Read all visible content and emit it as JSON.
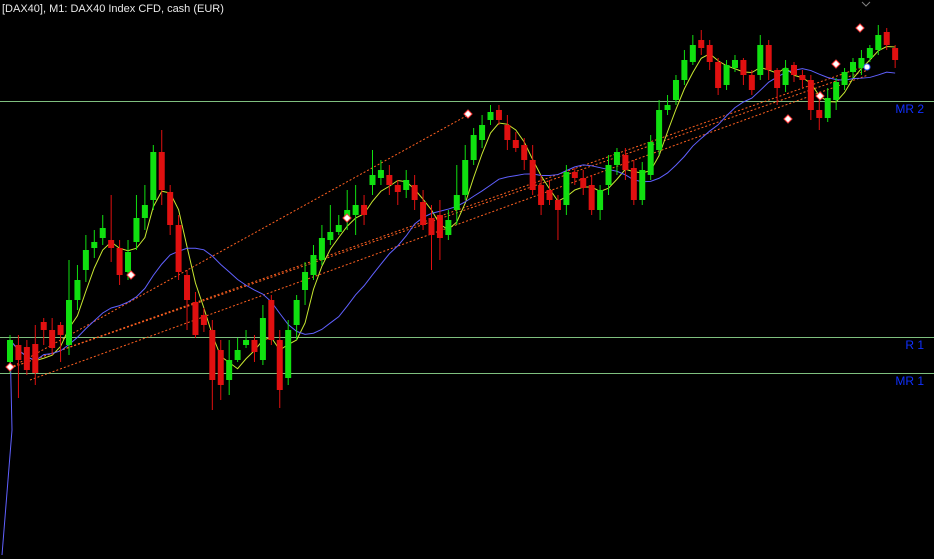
{
  "title": "[DAX40], M1:  DAX40 Index CFD, cash (EUR)",
  "colors": {
    "background": "#000000",
    "bull": "#10e010",
    "bear": "#e01010",
    "level_line": "#7fbf7f",
    "level_label": "#1030ff",
    "fast_ma": "#c8e830",
    "slow_ma": "#6060ff",
    "trendline": "#ff6020"
  },
  "levels": [
    {
      "label": "MR 2",
      "row": 101
    },
    {
      "label": "R 1",
      "row": 337
    },
    {
      "label": "MR 1",
      "row": 373
    }
  ],
  "chart_data": {
    "type": "candlestick",
    "candles": [
      [
        362,
        340,
        373,
        335
      ],
      [
        345,
        360,
        398,
        335
      ],
      [
        347,
        370,
        375,
        340
      ],
      [
        344,
        373,
        385,
        325
      ],
      [
        322,
        330,
        345,
        318
      ],
      [
        330,
        348,
        355,
        318
      ],
      [
        325,
        335,
        362,
        322
      ],
      [
        345,
        300,
        355,
        260
      ],
      [
        300,
        280,
        310,
        265
      ],
      [
        270,
        250,
        282,
        235
      ],
      [
        248,
        242,
        258,
        230
      ],
      [
        238,
        228,
        245,
        215
      ],
      [
        240,
        248,
        262,
        195
      ],
      [
        248,
        275,
        285,
        240
      ],
      [
        272,
        252,
        280,
        240
      ],
      [
        242,
        218,
        250,
        195
      ],
      [
        218,
        205,
        230,
        185
      ],
      [
        200,
        152,
        210,
        145
      ],
      [
        152,
        190,
        205,
        130
      ],
      [
        192,
        225,
        235,
        185
      ],
      [
        225,
        272,
        280,
        215
      ],
      [
        275,
        300,
        330,
        270
      ],
      [
        302,
        335,
        338,
        292
      ],
      [
        315,
        325,
        332,
        308
      ],
      [
        330,
        380,
        410,
        320
      ],
      [
        350,
        385,
        400,
        340
      ],
      [
        380,
        360,
        395,
        340
      ],
      [
        360,
        350,
        362,
        338
      ],
      [
        345,
        340,
        348,
        330
      ],
      [
        340,
        352,
        362,
        335
      ],
      [
        360,
        318,
        365,
        305
      ],
      [
        300,
        340,
        345,
        295
      ],
      [
        340,
        390,
        408,
        330
      ],
      [
        378,
        330,
        385,
        320
      ],
      [
        325,
        300,
        340,
        295
      ],
      [
        290,
        272,
        305,
        262
      ],
      [
        275,
        255,
        280,
        245
      ],
      [
        260,
        238,
        265,
        225
      ],
      [
        240,
        232,
        245,
        205
      ],
      [
        232,
        225,
        235,
        215
      ],
      [
        220,
        210,
        230,
        190
      ],
      [
        215,
        205,
        235,
        185
      ],
      [
        205,
        215,
        225,
        195
      ],
      [
        185,
        175,
        195,
        150
      ],
      [
        178,
        170,
        185,
        160
      ],
      [
        175,
        185,
        195,
        165
      ],
      [
        185,
        192,
        205,
        180
      ],
      [
        190,
        180,
        198,
        170
      ],
      [
        185,
        200,
        210,
        175
      ],
      [
        202,
        225,
        230,
        190
      ],
      [
        218,
        235,
        270,
        205
      ],
      [
        215,
        238,
        260,
        200
      ],
      [
        235,
        220,
        240,
        210
      ],
      [
        210,
        195,
        225,
        165
      ],
      [
        195,
        160,
        200,
        145
      ],
      [
        160,
        135,
        165,
        128
      ],
      [
        140,
        125,
        148,
        115
      ],
      [
        120,
        112,
        125,
        105
      ],
      [
        110,
        120,
        125,
        105
      ],
      [
        125,
        140,
        150,
        115
      ],
      [
        140,
        148,
        152,
        132
      ],
      [
        145,
        160,
        170,
        138
      ],
      [
        160,
        190,
        195,
        145
      ],
      [
        185,
        205,
        215,
        175
      ],
      [
        190,
        200,
        205,
        180
      ],
      [
        200,
        210,
        240,
        195
      ],
      [
        205,
        172,
        215,
        165
      ],
      [
        172,
        178,
        185,
        168
      ],
      [
        178,
        188,
        195,
        170
      ],
      [
        185,
        210,
        215,
        175
      ],
      [
        210,
        190,
        220,
        185
      ],
      [
        185,
        165,
        195,
        155
      ],
      [
        165,
        152,
        175,
        148
      ],
      [
        155,
        170,
        180,
        148
      ],
      [
        168,
        200,
        205,
        160
      ],
      [
        200,
        170,
        205,
        162
      ],
      [
        175,
        142,
        180,
        135
      ],
      [
        150,
        110,
        155,
        100
      ],
      [
        110,
        105,
        115,
        95
      ],
      [
        100,
        80,
        105,
        75
      ],
      [
        80,
        60,
        85,
        50
      ],
      [
        62,
        45,
        65,
        35
      ],
      [
        40,
        48,
        55,
        30
      ],
      [
        45,
        62,
        70,
        40
      ],
      [
        62,
        88,
        95,
        58
      ],
      [
        85,
        65,
        90,
        60
      ],
      [
        68,
        60,
        72,
        55
      ],
      [
        60,
        75,
        85,
        58
      ],
      [
        75,
        90,
        95,
        70
      ],
      [
        75,
        45,
        80,
        35
      ],
      [
        45,
        70,
        80,
        40
      ],
      [
        70,
        88,
        105,
        68
      ],
      [
        85,
        68,
        92,
        60
      ],
      [
        65,
        75,
        82,
        62
      ],
      [
        75,
        80,
        88,
        70
      ],
      [
        80,
        110,
        120,
        75
      ],
      [
        110,
        118,
        130,
        100
      ],
      [
        118,
        98,
        122,
        88
      ],
      [
        100,
        82,
        110,
        78
      ],
      [
        85,
        72,
        90,
        68
      ],
      [
        72,
        62,
        78,
        58
      ],
      [
        68,
        58,
        75,
        50
      ],
      [
        58,
        48,
        62,
        45
      ],
      [
        50,
        35,
        55,
        25
      ],
      [
        32,
        45,
        50,
        28
      ],
      [
        48,
        60,
        68,
        45
      ]
    ]
  }
}
